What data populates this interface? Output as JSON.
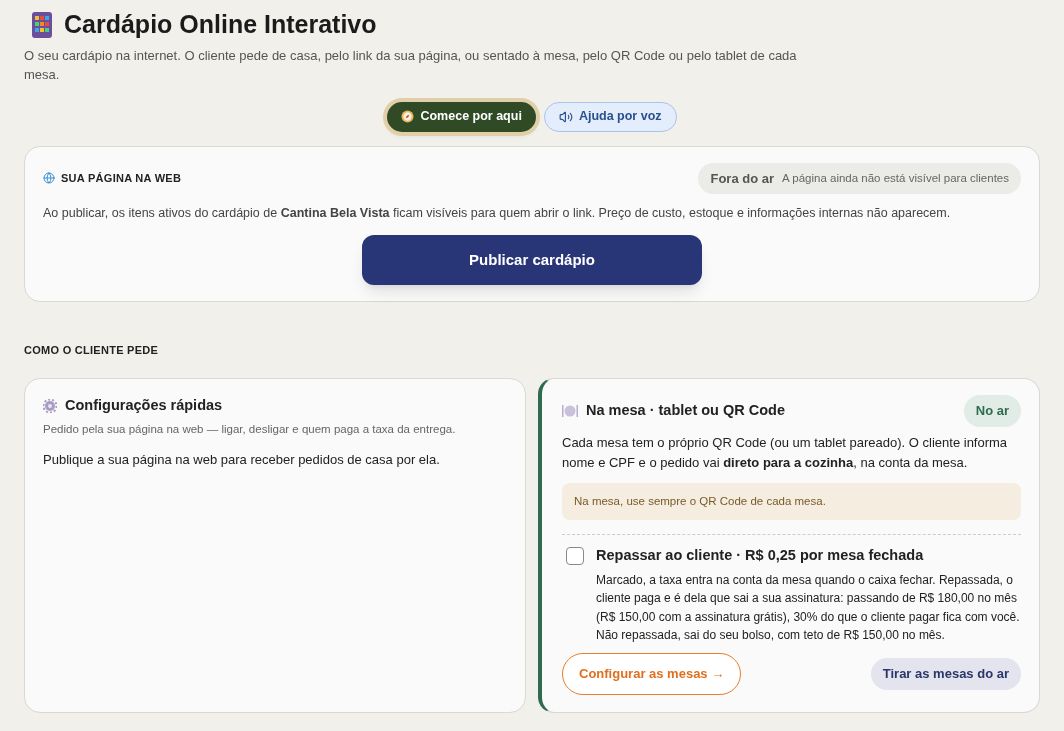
{
  "header": {
    "title": "Cardápio Online Interativo",
    "subtitle": "O seu cardápio na internet. O cliente pede de casa, pelo link da sua página, ou sentado à mesa, pelo QR Code ou pelo tablet de cada mesa.",
    "buttons": [
      {
        "label": "Comece por aqui",
        "kind": "primary"
      },
      {
        "label": "Ajuda por voz",
        "kind": "secondary"
      }
    ]
  },
  "web_panel": {
    "heading": "SUA PÁGINA NA WEB",
    "status": {
      "label": "Fora do ar",
      "detail": "A página ainda não está visível para clientes",
      "on": false
    },
    "description": "Ao publicar, os itens ativos do cardápio de **Cantina Bela Vista** ficam visíveis para quem abrir o link. Preço de custo, estoque e informações internas não aparecem.",
    "publish_button": "Publicar cardápio"
  },
  "section_heading": "COMO O CLIENTE PEDE",
  "quick_settings": {
    "title": "Configurações rápidas",
    "subtitle": "Pedido pela sua página na web — ligar, desligar e quem paga a taxa da entrega.",
    "message": "Publique a sua página na web para receber pedidos de casa por ela."
  },
  "table_channel": {
    "title": "Na mesa · tablet ou QR Code",
    "status": {
      "label": "No ar",
      "on": true
    },
    "description": "Cada mesa tem o próprio QR Code (ou um tablet pareado). O cliente informa nome e CPF e o pedido vai **direto para a cozinha**, na conta da mesa.",
    "notice": "Na mesa, use sempre o QR Code de cada mesa.",
    "pass_on": {
      "label": "Repassar ao cliente · R$ 0,25 por mesa fechada",
      "checked": false,
      "description": "Marcado, a taxa entra na conta da mesa quando o caixa fechar. Repassada, o cliente paga e é dela que sai a sua assinatura: passando de R$ 180,00 no mês (R$ 150,00 com a assinatura grátis), 30% do que o cliente pagar fica com você. Não repassada, sai do seu bolso, com teto de R$ 150,00 no mês."
    },
    "buttons": [
      {
        "label": "Configurar as mesas →",
        "kind": "outline"
      },
      {
        "label": "Tirar as mesas do ar",
        "kind": "muted"
      }
    ]
  }
}
